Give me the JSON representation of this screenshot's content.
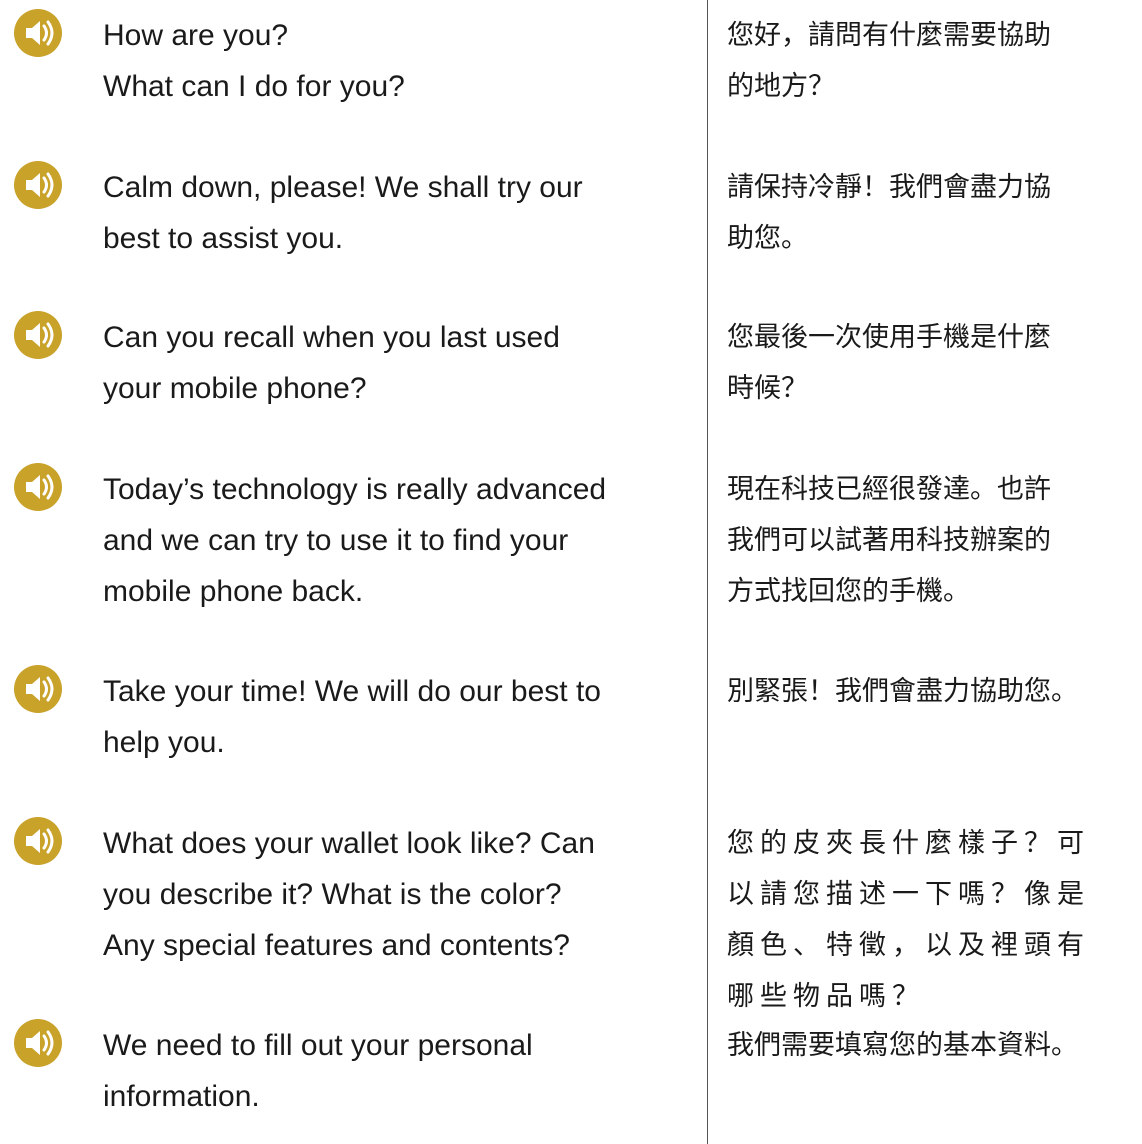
{
  "colors": {
    "audio_icon_fill": "#C9A22A",
    "audio_icon_glyph": "#ffffff",
    "divider": "#555555",
    "text": "#1a1a1a"
  },
  "audio_icon_name": "speaker-icon",
  "phrases": [
    {
      "en": [
        "How are you?",
        "What can I do for you?"
      ],
      "zh": [
        "您好，請問有什麼需要協助",
        "的地方？"
      ]
    },
    {
      "en": [
        "Calm down, please! We shall try our",
        "best to assist you."
      ],
      "zh": [
        "請保持冷靜！我們會盡力協",
        "助您。"
      ]
    },
    {
      "en": [
        "Can you recall when you last used",
        "your mobile phone?"
      ],
      "zh": [
        "您最後一次使用手機是什麼",
        "時候？"
      ]
    },
    {
      "en": [
        "Today’s technology is really advanced",
        "and we can try to use it to find your",
        "mobile phone back."
      ],
      "zh": [
        "現在科技已經很發達。也許",
        "我們可以試著用科技辦案的",
        "方式找回您的手機。"
      ]
    },
    {
      "en": [
        "Take your time! We will do our best to",
        "help you."
      ],
      "zh": [
        "別緊張！我們會盡力協助您。"
      ]
    },
    {
      "en": [
        "What does your wallet look like? Can",
        "you describe it? What is the color?",
        "Any special features and contents?"
      ],
      "zh": [
        "您的皮夾長什麼樣子？可",
        "以請您描述一下嗎？像是",
        "顏色、特徵，以及裡頭有",
        "哪些物品嗎？"
      ]
    },
    {
      "en": [
        "We need to fill out your personal",
        "information."
      ],
      "zh": [
        "我們需要填寫您的基本資料。"
      ]
    }
  ]
}
